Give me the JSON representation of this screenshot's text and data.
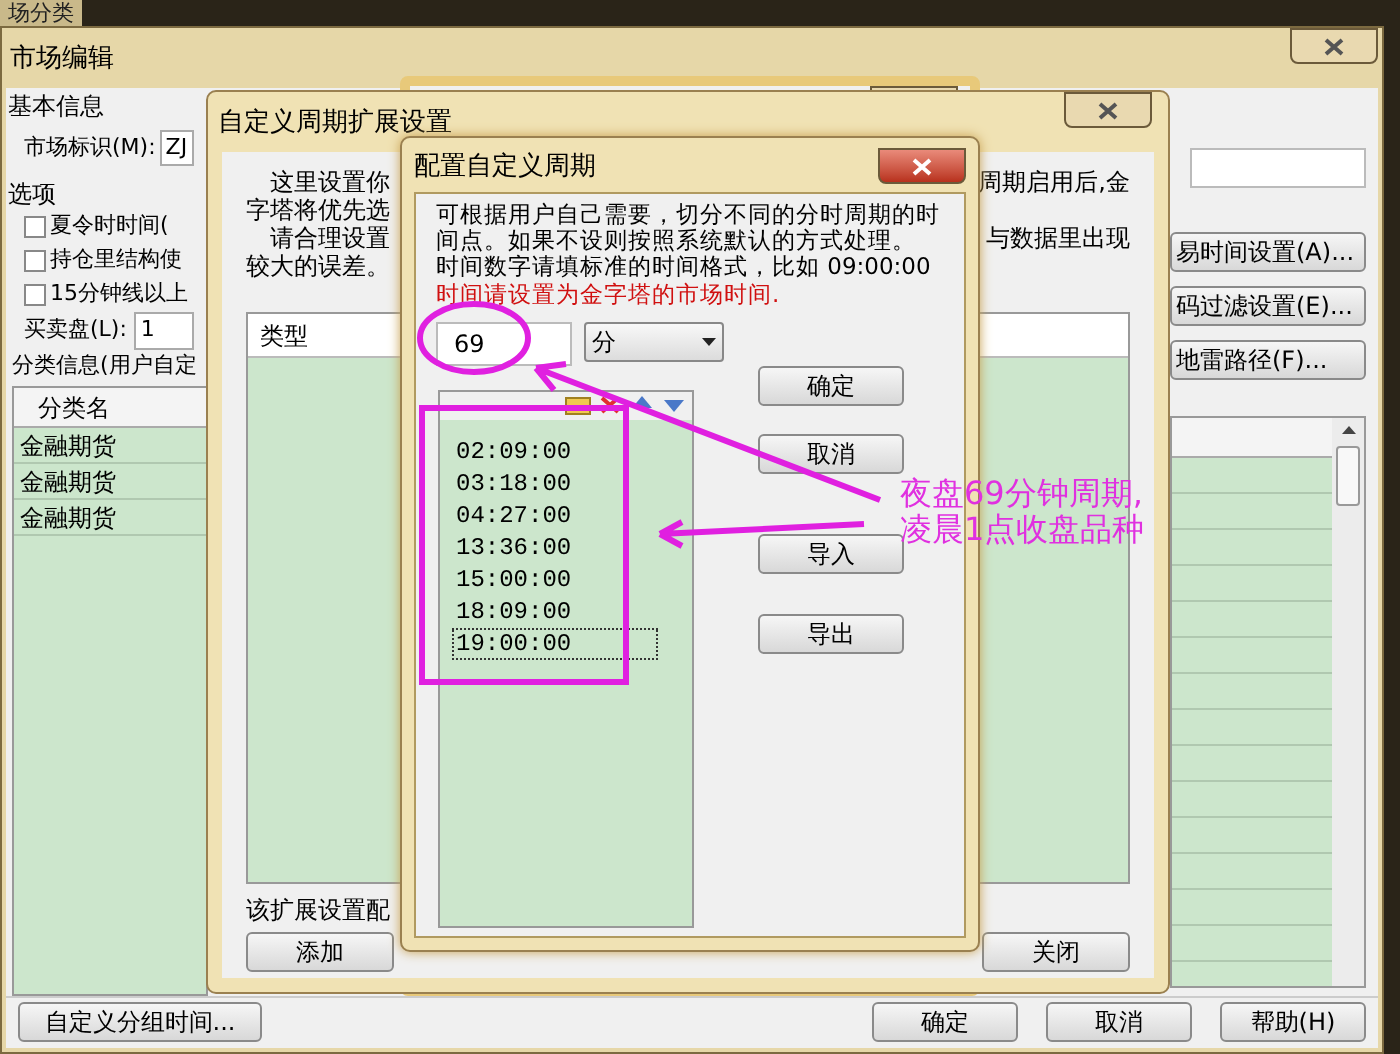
{
  "back_window": {
    "title": "场分类"
  },
  "main_window": {
    "title": "市场编辑",
    "basic_info": "基本信息",
    "market_id_label": "市场标识(M):",
    "market_id_value": "ZJ",
    "options_label": "选项",
    "checkboxes": [
      {
        "label": "夏令时时间(",
        "checked": false
      },
      {
        "label": "持仓里结构使",
        "checked": false
      },
      {
        "label": "15分钟线以上",
        "checked": false
      }
    ],
    "trade_label": "买卖盘(L):",
    "trade_value": "1",
    "category_label": "分类信息(用户自定",
    "table": {
      "header": "分类名",
      "rows": [
        "金融期货",
        "金融期货",
        "金融期货"
      ]
    },
    "side_buttons": [
      "易时间设置(A)...",
      "码过滤设置(E)...",
      "地雷路径(F)..."
    ],
    "bottom_buttons": [
      "自定义分组时间...",
      "确定",
      "取消",
      "帮助(H)"
    ]
  },
  "extension_dialog": {
    "title": "自定义周期扩展设置",
    "lines": [
      {
        "left": "这里设置你",
        "right": "周期启用后,金"
      },
      {
        "left": "字塔将优先选"
      },
      {
        "left": "请合理设置",
        "right": "与数据里出现"
      },
      {
        "left": "较大的误差。"
      }
    ],
    "table_header": "类型",
    "footer_label": "该扩展设置配",
    "buttons": [
      "添加",
      "关闭"
    ]
  },
  "period_dialog": {
    "title": "配置自定义周期",
    "intro": [
      "可根据用户自己需要，切分不同的分时周期的时",
      "间点。如果不设则按照系统默认的方式处理。",
      "时间数字请填标准的时间格式，比如 09:00:00"
    ],
    "warning": "时间请设置为金字塔的市场时间.",
    "period_value": "69",
    "unit": "分",
    "times": [
      {
        "text": "02:09:00",
        "selected": false
      },
      {
        "text": "03:18:00",
        "selected": false
      },
      {
        "text": "04:27:00",
        "selected": false
      },
      {
        "text": "13:36:00",
        "selected": false
      },
      {
        "text": "15:00:00",
        "selected": false
      },
      {
        "text": "18:09:00",
        "selected": false
      },
      {
        "text": "19:00:00",
        "selected": true
      }
    ],
    "buttons": [
      "确定",
      "取消",
      "导入",
      "导出"
    ]
  },
  "annotation": {
    "lines": [
      "夜盘69分钟周期,",
      "凌晨1点收盘品种"
    ]
  }
}
